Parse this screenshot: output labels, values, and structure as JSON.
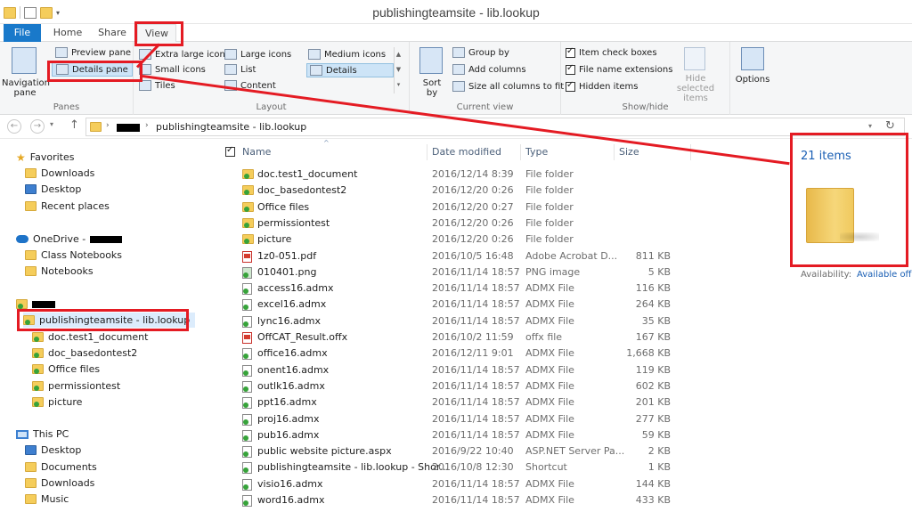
{
  "window": {
    "title": "publishingteamsite - lib.lookup"
  },
  "tabs": {
    "file": "File",
    "home": "Home",
    "share": "Share",
    "view": "View"
  },
  "ribbon": {
    "panes": {
      "navigation_pane": "Navigation pane",
      "preview_pane": "Preview pane",
      "details_pane": "Details pane",
      "group_label": "Panes"
    },
    "layout": {
      "extra_large_icons": "Extra large icons",
      "large_icons": "Large icons",
      "medium_icons": "Medium icons",
      "small_icons": "Small icons",
      "list": "List",
      "details": "Details",
      "tiles": "Tiles",
      "content": "Content",
      "group_label": "Layout"
    },
    "current_view": {
      "sort_by": "Sort by",
      "group_by": "Group by",
      "add_columns": "Add columns",
      "size_all_columns": "Size all columns to fit",
      "group_label": "Current view"
    },
    "show_hide": {
      "item_check_boxes": "Item check boxes",
      "file_name_extensions": "File name extensions",
      "hidden_items": "Hidden items",
      "hide_selected_items": "Hide selected items",
      "group_label": "Show/hide"
    },
    "options": "Options"
  },
  "address": {
    "crumb": "publishingteamsite - lib.lookup"
  },
  "nav": {
    "favorites": "Favorites",
    "downloads": "Downloads",
    "desktop": "Desktop",
    "recent_places": "Recent places",
    "onedrive": "OneDrive -",
    "class_notebooks": "Class Notebooks",
    "notebooks": "Notebooks",
    "site": "publishingteamsite - lib.lookup",
    "children": [
      "doc.test1_document",
      "doc_basedontest2",
      "Office files",
      "permissiontest",
      "picture"
    ],
    "this_pc": "This PC",
    "pc_desktop": "Desktop",
    "pc_documents": "Documents",
    "pc_downloads": "Downloads",
    "pc_music": "Music"
  },
  "columns": {
    "name": "Name",
    "date": "Date modified",
    "type": "Type",
    "size": "Size"
  },
  "files": [
    {
      "name": "doc.test1_document",
      "date": "2016/12/14 8:39",
      "type": "File folder",
      "size": "",
      "icon": "folder-icon"
    },
    {
      "name": "doc_basedontest2",
      "date": "2016/12/20 0:26",
      "type": "File folder",
      "size": "",
      "icon": "folder-icon"
    },
    {
      "name": "Office files",
      "date": "2016/12/20 0:27",
      "type": "File folder",
      "size": "",
      "icon": "folder-icon"
    },
    {
      "name": "permissiontest",
      "date": "2016/12/20 0:26",
      "type": "File folder",
      "size": "",
      "icon": "folder-icon"
    },
    {
      "name": "picture",
      "date": "2016/12/20 0:26",
      "type": "File folder",
      "size": "",
      "icon": "folder-icon"
    },
    {
      "name": "1z0-051.pdf",
      "date": "2016/10/5 16:48",
      "type": "Adobe Acrobat D...",
      "size": "811 KB",
      "icon": "pdf-icon"
    },
    {
      "name": "010401.png",
      "date": "2016/11/14 18:57",
      "type": "PNG image",
      "size": "5 KB",
      "icon": "image-icon"
    },
    {
      "name": "access16.admx",
      "date": "2016/11/14 18:57",
      "type": "ADMX File",
      "size": "116 KB",
      "icon": "file-icon"
    },
    {
      "name": "excel16.admx",
      "date": "2016/11/14 18:57",
      "type": "ADMX File",
      "size": "264 KB",
      "icon": "file-icon"
    },
    {
      "name": "lync16.admx",
      "date": "2016/11/14 18:57",
      "type": "ADMX File",
      "size": "35 KB",
      "icon": "file-icon"
    },
    {
      "name": "OffCAT_Result.offx",
      "date": "2016/10/2 11:59",
      "type": "offx file",
      "size": "167 KB",
      "icon": "offx-icon"
    },
    {
      "name": "office16.admx",
      "date": "2016/12/11 9:01",
      "type": "ADMX File",
      "size": "1,668 KB",
      "icon": "file-icon"
    },
    {
      "name": "onent16.admx",
      "date": "2016/11/14 18:57",
      "type": "ADMX File",
      "size": "119 KB",
      "icon": "file-icon"
    },
    {
      "name": "outlk16.admx",
      "date": "2016/11/14 18:57",
      "type": "ADMX File",
      "size": "602 KB",
      "icon": "file-icon"
    },
    {
      "name": "ppt16.admx",
      "date": "2016/11/14 18:57",
      "type": "ADMX File",
      "size": "201 KB",
      "icon": "file-icon"
    },
    {
      "name": "proj16.admx",
      "date": "2016/11/14 18:57",
      "type": "ADMX File",
      "size": "277 KB",
      "icon": "file-icon"
    },
    {
      "name": "pub16.admx",
      "date": "2016/11/14 18:57",
      "type": "ADMX File",
      "size": "59 KB",
      "icon": "file-icon"
    },
    {
      "name": "public website picture.aspx",
      "date": "2016/9/22 10:40",
      "type": "ASP.NET Server Pa...",
      "size": "2 KB",
      "icon": "aspx-icon"
    },
    {
      "name": "publishingteamsite - lib.lookup - Shor...",
      "date": "2016/10/8 12:30",
      "type": "Shortcut",
      "size": "1 KB",
      "icon": "shortcut-icon"
    },
    {
      "name": "visio16.admx",
      "date": "2016/11/14 18:57",
      "type": "ADMX File",
      "size": "144 KB",
      "icon": "file-icon"
    },
    {
      "name": "word16.admx",
      "date": "2016/11/14 18:57",
      "type": "ADMX File",
      "size": "433 KB",
      "icon": "file-icon"
    }
  ],
  "details_pane": {
    "count": "21 items",
    "availability_label": "Availability:",
    "availability_value": "Available off"
  },
  "colors": {
    "accent": "#1979ca",
    "annotation": "#e41b23",
    "link": "#1a5fb4"
  }
}
